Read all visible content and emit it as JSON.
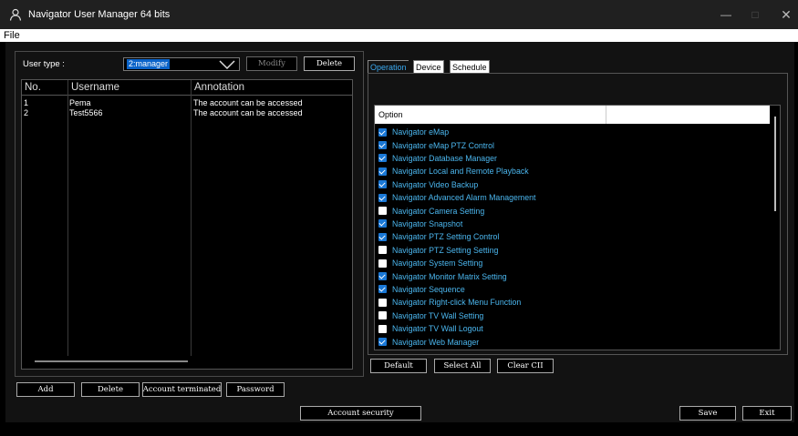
{
  "window": {
    "title": "Navigator User Manager 64 bits",
    "min_glyph": "—",
    "max_glyph": "□",
    "close_glyph": "✕"
  },
  "menu": {
    "file": "File"
  },
  "user_panel": {
    "user_type_label": "User type :",
    "user_type_value": "2:manager",
    "modify_label": "Modify",
    "delete_top_label": "Delete",
    "columns": [
      "No.",
      "Username",
      "Annotation"
    ],
    "rows": [
      {
        "no": "1",
        "username": "Pema",
        "annotation": "The account can be accessed"
      },
      {
        "no": "2",
        "username": "Test5566",
        "annotation": "The account can be accessed"
      }
    ],
    "buttons": {
      "add": "Add",
      "delete": "Delete",
      "account_terminated": "Account terminated",
      "password": "Password"
    }
  },
  "tabs": [
    "Operation",
    "Device",
    "Schedule"
  ],
  "options": {
    "header": "Option",
    "items": [
      {
        "label": "Navigator eMap",
        "checked": true
      },
      {
        "label": "Navigator eMap PTZ Control",
        "checked": true
      },
      {
        "label": "Navigator Database Manager",
        "checked": true
      },
      {
        "label": "Navigator Local and Remote Playback",
        "checked": true
      },
      {
        "label": "Navigator Video Backup",
        "checked": true
      },
      {
        "label": "Navigator Advanced Alarm Management",
        "checked": true
      },
      {
        "label": "Navigator Camera Setting",
        "checked": false
      },
      {
        "label": "Navigator Snapshot",
        "checked": true
      },
      {
        "label": "Navigator PTZ Setting Control",
        "checked": true
      },
      {
        "label": "Navigator PTZ Setting Setting",
        "checked": false
      },
      {
        "label": "Navigator System Setting",
        "checked": false
      },
      {
        "label": "Navigator Monitor Matrix Setting",
        "checked": true
      },
      {
        "label": "Navigator Sequence",
        "checked": true
      },
      {
        "label": "Navigator Right-click Menu Function",
        "checked": false
      },
      {
        "label": "Navigator TV Wall Setting",
        "checked": false
      },
      {
        "label": "Navigator TV Wall Logout",
        "checked": false
      },
      {
        "label": "Navigator Web Manager",
        "checked": true
      }
    ],
    "buttons": {
      "default": "Default",
      "select_all": "Select All",
      "clear_all": "Clear CII"
    }
  },
  "footer": {
    "account_security": "Account security",
    "save": "Save",
    "exit": "Exit"
  },
  "colors": {
    "accent": "#3aa9f0",
    "checkbox_on": "#1a78d6",
    "selection": "#0a63c9"
  }
}
